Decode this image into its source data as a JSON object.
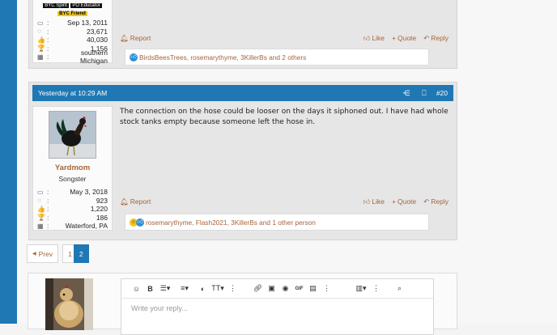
{
  "post1": {
    "badges": {
      "top_a": "BYC Spirit",
      "top_b": "PO Educator",
      "friend": "BYC Friend"
    },
    "stats": [
      {
        "icon": "calendar-icon",
        "glyph": "▭",
        "value": "Sep 13, 2011"
      },
      {
        "icon": "messages-icon",
        "glyph": "◌",
        "value": "23,671"
      },
      {
        "icon": "thumbs-up-icon",
        "glyph": "👍",
        "value": "40,030"
      },
      {
        "icon": "trophy-icon",
        "glyph": "🏆",
        "value": "1,156"
      },
      {
        "icon": "map-icon",
        "glyph": "▦",
        "value": "southern Michigan"
      }
    ],
    "actions": {
      "report": "Report",
      "like": "Like",
      "quote": "Quote",
      "reply": "Reply"
    },
    "reactions": "BirdsBeesTrees, rosemarythyme, 3KillerBs and 2 others"
  },
  "post2": {
    "timestamp": "Yesterday at 10:29 AM",
    "number": "#20",
    "username": "Yardmom",
    "usertitle": "Songster",
    "stats": [
      {
        "icon": "calendar-icon",
        "glyph": "▭",
        "value": "May 3, 2018"
      },
      {
        "icon": "messages-icon",
        "glyph": "◌",
        "value": "923"
      },
      {
        "icon": "thumbs-up-icon",
        "glyph": "👍",
        "value": "1,220"
      },
      {
        "icon": "trophy-icon",
        "glyph": "🏆",
        "value": "186"
      },
      {
        "icon": "map-icon",
        "glyph": "▦",
        "value": "Waterford, PA"
      }
    ],
    "body": "The connection on the hose could be looser on the days it siphoned out. I have had whole stock tanks empty because someone left the hose in.",
    "actions": {
      "report": "Report",
      "like": "Like",
      "quote": "Quote",
      "reply": "Reply"
    },
    "reactions": "rosemarythyme, Flash2021, 3KillerBs and 1 other person"
  },
  "pagination": {
    "prev": "Prev",
    "pages": [
      "1",
      "2"
    ],
    "current": "2"
  },
  "reply": {
    "placeholder": "Write your reply..."
  },
  "colors": {
    "accent": "#1f78b4",
    "link": "#a7633a",
    "post_bg": "#e6e6e6"
  }
}
